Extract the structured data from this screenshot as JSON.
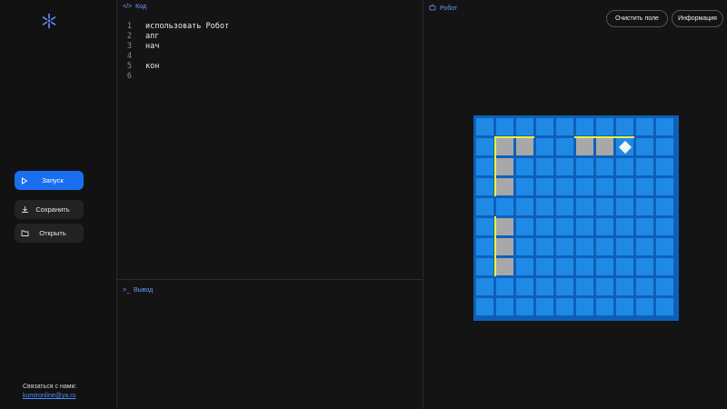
{
  "sidebar": {
    "logo_icon": "snowflake-logo-icon",
    "run_label": "Запуск",
    "save_label": "Сохранить",
    "open_label": "Открыть",
    "contact_label": "Связаться с нами:",
    "contact_email": "kumironline@ya.ru"
  },
  "code_pane": {
    "title": "Код",
    "lines": [
      {
        "n": "1",
        "text": "использовать Робот"
      },
      {
        "n": "2",
        "text": "алг"
      },
      {
        "n": "3",
        "text": "нач"
      },
      {
        "n": "4",
        "text": ""
      },
      {
        "n": "5",
        "text": "кон"
      },
      {
        "n": "6",
        "text": ""
      }
    ]
  },
  "output_pane": {
    "title": "Вывод"
  },
  "robot_pane": {
    "title": "Робот",
    "clear_label": "Очистить поле",
    "info_label": "Информация",
    "field": {
      "cols": 10,
      "rows": 10,
      "painted": [
        [
          1,
          1
        ],
        [
          2,
          1
        ],
        [
          5,
          1
        ],
        [
          6,
          1
        ],
        [
          1,
          2
        ],
        [
          1,
          3
        ],
        [
          1,
          5
        ],
        [
          1,
          6
        ],
        [
          1,
          7
        ]
      ],
      "robot": [
        7,
        1
      ],
      "walls": [
        {
          "side": "top",
          "col": 1,
          "row": 1
        },
        {
          "side": "top",
          "col": 2,
          "row": 1
        },
        {
          "side": "top",
          "col": 5,
          "row": 1
        },
        {
          "side": "top",
          "col": 6,
          "row": 1
        },
        {
          "side": "top",
          "col": 7,
          "row": 1
        },
        {
          "side": "left",
          "col": 1,
          "row": 1
        },
        {
          "side": "left",
          "col": 1,
          "row": 2
        },
        {
          "side": "left",
          "col": 1,
          "row": 3
        },
        {
          "side": "left",
          "col": 1,
          "row": 5
        },
        {
          "side": "left",
          "col": 1,
          "row": 6
        },
        {
          "side": "left",
          "col": 1,
          "row": 7
        }
      ],
      "colors": {
        "cell": "#1e8ae6",
        "painted": "#a8a8a8",
        "wall": "#e8f23a",
        "robot": "#f4f4f4"
      }
    }
  }
}
